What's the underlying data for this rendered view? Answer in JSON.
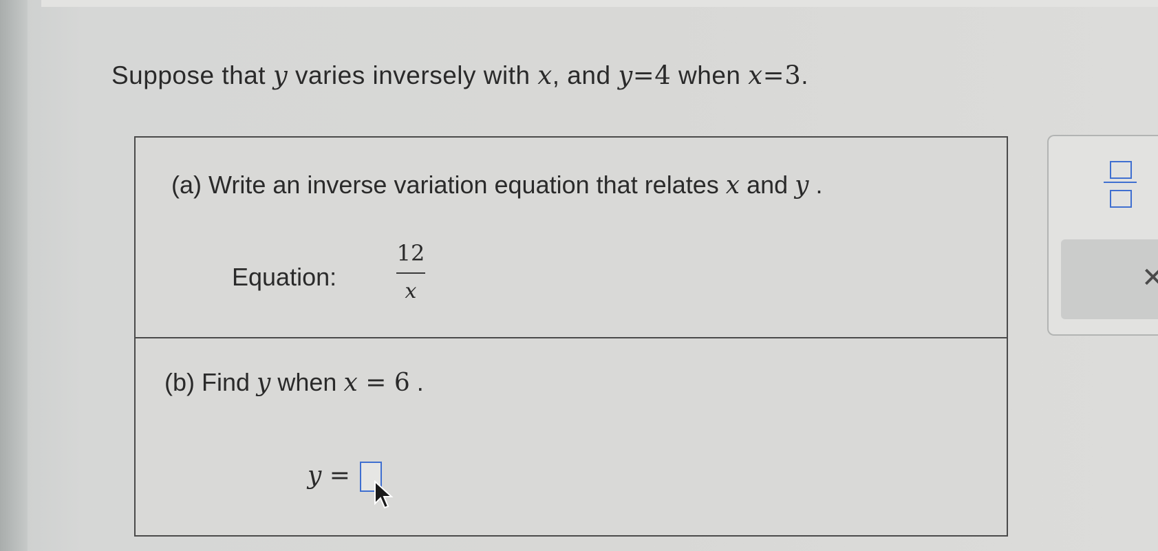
{
  "problem": {
    "p1": "Suppose that ",
    "v1": "y",
    "p2": " varies inversely with ",
    "v2": "x",
    "p3": ", and ",
    "v3": "y",
    "p4": "=",
    "n1": "4",
    "p5": " when ",
    "v4": "x",
    "p6": "=",
    "n2": "3",
    "p7": "."
  },
  "part_a": {
    "prompt_start": "(a) Write an inverse variation equation that relates ",
    "var_x": "x",
    "and": " and ",
    "var_y": "y",
    "end": " .",
    "equation_label": "Equation:",
    "numerator": "12",
    "denominator": "x"
  },
  "part_b": {
    "prompt_start": "(b) Find ",
    "var_y": "y",
    "when": " when ",
    "var_x": "x",
    "equals": " = ",
    "value": "6",
    "end": " .",
    "answer_var": "y",
    "answer_eq": " ="
  },
  "toolbar": {
    "fraction_icon": "fraction-icon",
    "clear_label": "✕"
  },
  "colors": {
    "accent": "#3f6fd0",
    "border": "#4a4a4a"
  }
}
